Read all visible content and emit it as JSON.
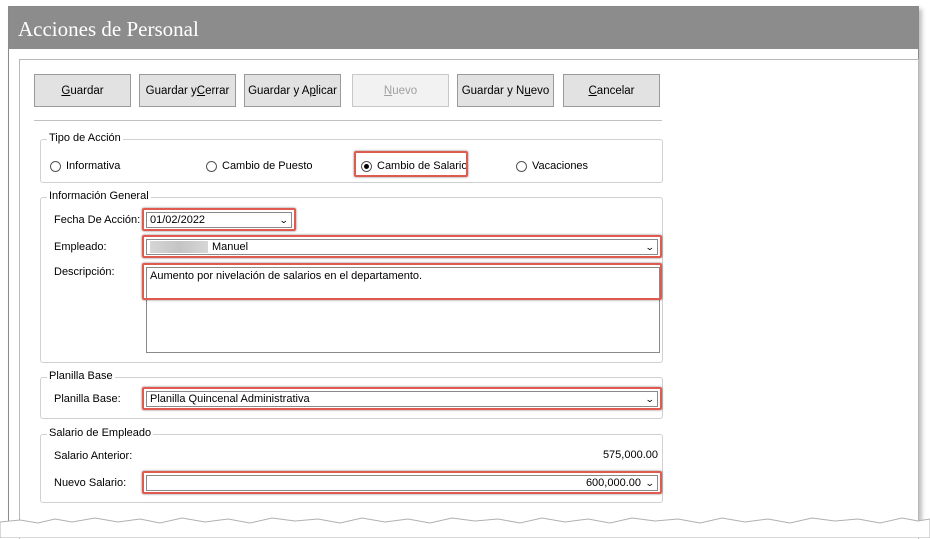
{
  "window": {
    "title": "Acciones de Personal"
  },
  "toolbar": {
    "guardar": {
      "pre": "",
      "u": "G",
      "post": "uardar"
    },
    "guardar_cerrar": {
      "pre": "Guardar y ",
      "u": "C",
      "post": "errar"
    },
    "guardar_aplicar": {
      "pre": "Guardar y A",
      "u": "p",
      "post": "licar"
    },
    "nuevo": {
      "pre": "",
      "u": "N",
      "post": "uevo"
    },
    "guardar_nuevo": {
      "pre": "Guardar y N",
      "u": "u",
      "post": "evo"
    },
    "cancelar": {
      "pre": "",
      "u": "C",
      "post": "ancelar"
    }
  },
  "tipo_accion": {
    "title": "Tipo de Acción",
    "options": [
      "Informativa",
      "Cambio de Puesto",
      "Cambio de Salario",
      "Vacaciones"
    ],
    "selected": "Cambio de Salario"
  },
  "info_general": {
    "title": "Información General",
    "fecha_label": "Fecha De Acción:",
    "fecha_value": "01/02/2022",
    "empleado_label": "Empleado:",
    "empleado_value": "Manuel",
    "descripcion_label": "Descripción:",
    "descripcion_value": "Aumento por nivelación de salarios en el  departamento."
  },
  "planilla": {
    "title": "Planilla Base",
    "label": "Planilla Base:",
    "value": "Planilla Quincenal Administrativa"
  },
  "salario": {
    "title": "Salario de Empleado",
    "anterior_label": "Salario Anterior:",
    "anterior_value": "575,000.00",
    "nuevo_label": "Nuevo Salario:",
    "nuevo_value": "600,000.00"
  },
  "colors": {
    "highlight": "#e05a50",
    "titlebar": "#8c8c8c"
  }
}
